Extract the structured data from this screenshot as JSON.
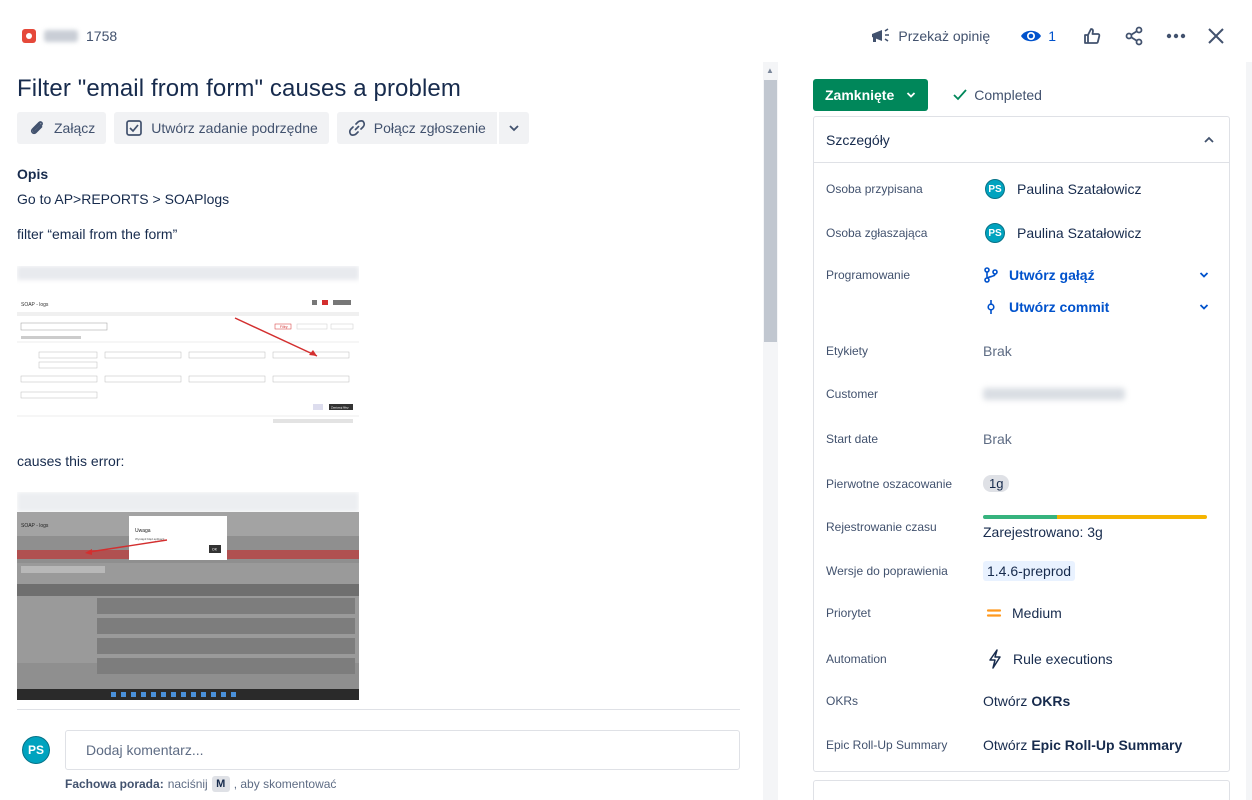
{
  "header": {
    "issue_number": "1758",
    "actions": {
      "feedback_label": "Przekaż opinię",
      "watchers_count": "1"
    }
  },
  "issue": {
    "title": "Filter \"email from form\" causes a problem",
    "toolbar": {
      "attach_label": "Załącz",
      "subtask_label": "Utwórz zadanie podrzędne",
      "link_label": "Połącz zgłoszenie"
    },
    "description": {
      "label": "Opis",
      "line1": "Go to AP>REPORTS > SOAPlogs",
      "line2": "filter “email from the form”",
      "line3": "causes this error:"
    },
    "comment": {
      "avatar_initials": "PS",
      "placeholder": "Dodaj komentarz...",
      "tip_bold": "Fachowa porada:",
      "tip_press": "naciśnij",
      "tip_key": "M",
      "tip_rest": ", aby skomentować"
    }
  },
  "screenshots": {
    "first": {
      "page_title": "SOAP - logs",
      "filter_label": "Filtry",
      "ok_label": "Zastosuj filtry"
    },
    "second": {
      "page_title": "SOAP - logs",
      "dialog_title": "Uwaga",
      "dialog_text": "Wystąpił błąd aplikacji",
      "dialog_ok": "OK"
    }
  },
  "sidebar": {
    "status_label": "Zamknięte",
    "resolution": "Completed",
    "details_heading": "Szczegóły",
    "fields": {
      "assignee_label": "Osoba przypisana",
      "assignee_initials": "PS",
      "assignee_name": "Paulina Szatałowicz",
      "reporter_label": "Osoba zgłaszająca",
      "reporter_initials": "PS",
      "reporter_name": "Paulina Szatałowicz",
      "development_label": "Programowanie",
      "create_branch": "Utwórz gałąź",
      "create_commit": "Utwórz commit",
      "labels_label": "Etykiety",
      "labels_value": "Brak",
      "customer_label": "Customer",
      "start_date_label": "Start date",
      "start_date_value": "Brak",
      "estimate_label": "Pierwotne oszacowanie",
      "estimate_value": "1g",
      "time_tracking_label": "Rejestrowanie czasu",
      "time_tracking_value": "Zarejestrowano: 3g",
      "time_logged_fraction": 0.33,
      "fix_versions_label": "Wersje do poprawienia",
      "fix_versions_value": "1.4.6-preprod",
      "priority_label": "Priorytet",
      "priority_value": "Medium",
      "automation_label": "Automation",
      "automation_value": "Rule executions",
      "okrs_label": "OKRs",
      "okrs_prefix": "Otwórz",
      "okrs_bold": "OKRs",
      "epic_label": "Epic Roll-Up Summary",
      "epic_prefix": "Otwórz",
      "epic_bold": "Epic Roll-Up Summary"
    }
  },
  "colors": {
    "status_green": "#00875a",
    "link_blue": "#0052cc",
    "avatar_teal": "#00a3bf",
    "priority_orange": "#ff991f",
    "time_logged": "#36b37e",
    "time_remaining": "#f5b400"
  }
}
